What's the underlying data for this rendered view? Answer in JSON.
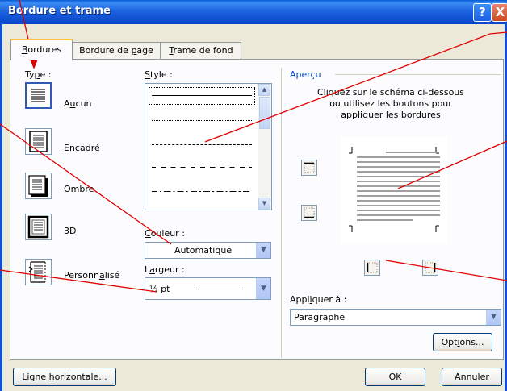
{
  "window": {
    "title": "Bordure et trame"
  },
  "titlebar": {
    "help": "?",
    "close": "X"
  },
  "tabs": [
    {
      "label": "Bordures",
      "mnemonic": "B",
      "rest": "ordures"
    },
    {
      "label": "Bordure de page",
      "pre": "Bordure de ",
      "mnemonic": "p",
      "rest": "age"
    },
    {
      "label": "Trame de fond",
      "mnemonic": "T",
      "rest": "rame de fond"
    }
  ],
  "type_group": {
    "label_pre": "Ty",
    "label_mn": "p",
    "label_post": "e :",
    "items": [
      {
        "pre": "A",
        "mn": "u",
        "post": "cun"
      },
      {
        "pre": "",
        "mn": "E",
        "post": "ncadré"
      },
      {
        "pre": "",
        "mn": "O",
        "post": "mbre"
      },
      {
        "pre": "3",
        "mn": "D",
        "post": ""
      },
      {
        "pre": "Personn",
        "mn": "a",
        "post": "lisé"
      }
    ]
  },
  "style_group": {
    "mn": "S",
    "post": "tyle :"
  },
  "color_group": {
    "mn": "C",
    "post": "ouleur :",
    "value": "Automatique"
  },
  "width_group": {
    "pre": "L",
    "mn": "a",
    "post": "rgeur :",
    "value": "½ pt"
  },
  "preview_group": {
    "label": "Aperçu",
    "instructions": [
      "Cliquez sur le schéma ci-dessous",
      "ou utilisez les boutons pour",
      "appliquer les bordures"
    ]
  },
  "apply_group": {
    "pre": "Appl",
    "mn": "i",
    "post": "quer à :",
    "value": "Paragraphe"
  },
  "buttons": {
    "options": {
      "pre": "Opt",
      "mn": "i",
      "post": "ons..."
    },
    "horizontal_line": {
      "pre": "Ligne ",
      "mn": "h",
      "post": "orizontale..."
    },
    "ok": "OK",
    "cancel": "Annuler"
  },
  "colors": {
    "titlebar": "#0f4fd2",
    "annotation": "#e00000",
    "tab_highlight": "#ffc73c"
  }
}
